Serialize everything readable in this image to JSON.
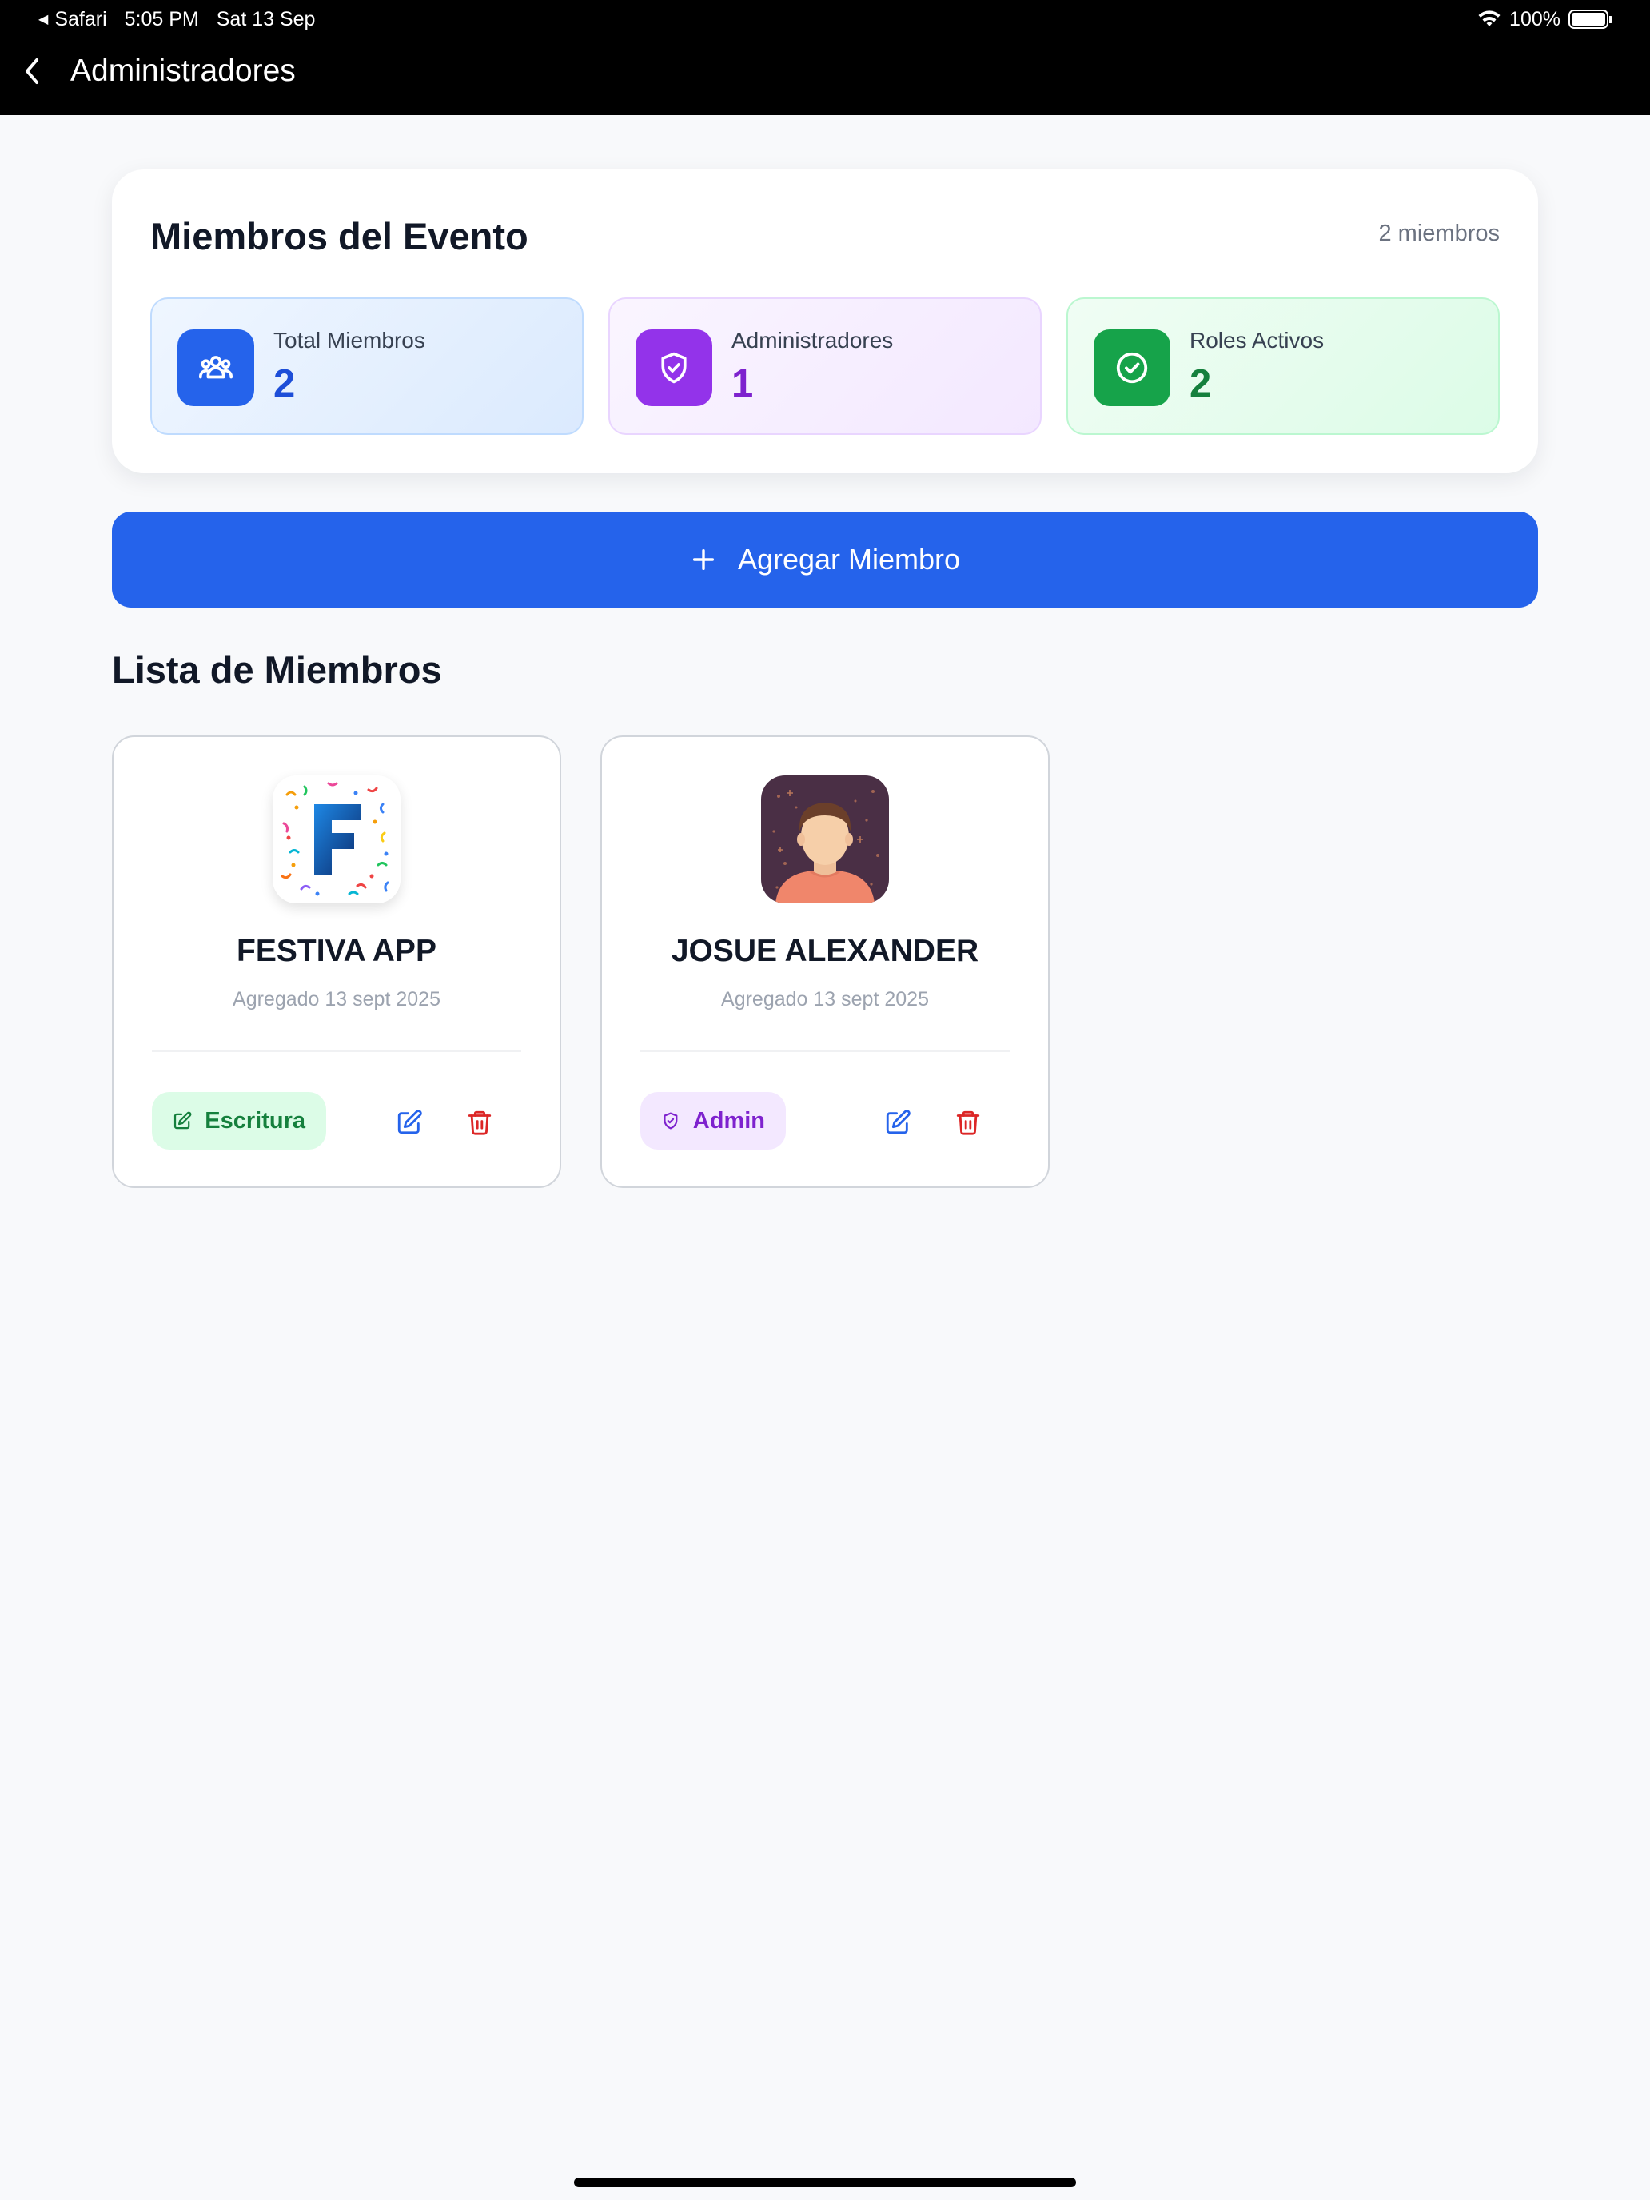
{
  "status_bar": {
    "back_app": "Safari",
    "time": "5:05 PM",
    "date": "Sat 13 Sep",
    "battery": "100%",
    "battery_level": 1.0
  },
  "nav": {
    "title": "Administradores"
  },
  "summary": {
    "title": "Miembros del Evento",
    "count_text": "2 miembros",
    "stats": [
      {
        "label": "Total Miembros",
        "value": "2",
        "icon": "users-icon",
        "color": "#2563eb"
      },
      {
        "label": "Administradores",
        "value": "1",
        "icon": "shield-icon",
        "color": "#9333ea"
      },
      {
        "label": "Roles Activos",
        "value": "2",
        "icon": "check-circle-icon",
        "color": "#16a34a"
      }
    ]
  },
  "add_button": {
    "label": "Agregar Miembro"
  },
  "section_title": "Lista de Miembros",
  "members": [
    {
      "name": "FESTIVA APP",
      "added": "Agregado 13 sept 2025",
      "avatar": "festiva-logo",
      "role": "Escritura",
      "role_icon": "edit-square-icon",
      "role_color": "#15803d"
    },
    {
      "name": "JOSUE ALEXANDER",
      "added": "Agregado 13 sept 2025",
      "avatar": "person-avatar",
      "role": "Admin",
      "role_icon": "shield-icon",
      "role_color": "#7e22ce"
    }
  ],
  "colors": {
    "primary": "#2563eb",
    "danger": "#dc2626",
    "background": "#f8f9fb"
  }
}
